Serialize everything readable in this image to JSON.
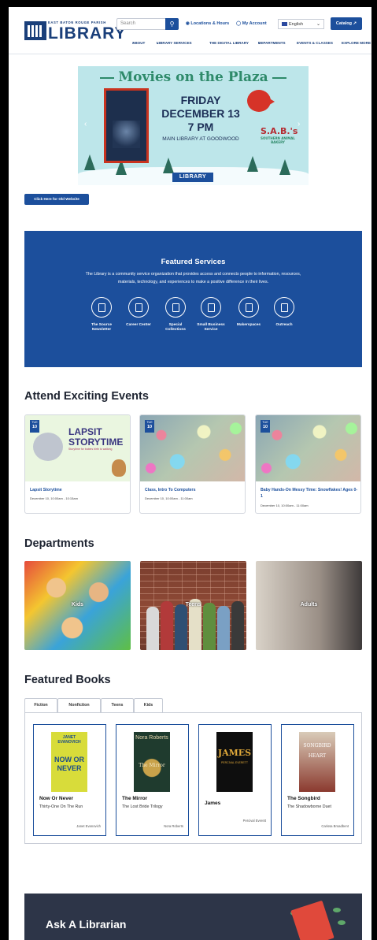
{
  "header": {
    "logo_small": "EAST BATON ROUGE PARISH",
    "logo_big": "LIBRARY",
    "search_placeholder": "Search",
    "locations_label": "Locations & Hours",
    "account_label": "My Account",
    "language": "English",
    "catalog_label": "Catalog",
    "nav": [
      "ABOUT",
      "LIBRARY SERVICES",
      "THE DIGITAL LIBRARY",
      "DEPARTMENTS",
      "EVENTS & CLASSES",
      "EXPLORE MORE"
    ]
  },
  "banner": {
    "title": "Movies on the Plaza",
    "day": "FRIDAY",
    "date": "DECEMBER 13",
    "time": "7 PM",
    "location": "MAIN LIBRARY AT GOODWOOD",
    "sabs": "S.A.B.'s",
    "sabs_sub": "SOUTHERN ANIMAL BAKERY",
    "logo": "LIBRARY"
  },
  "old_site_button": "Click Here for Old Website",
  "featured_services": {
    "title": "Featured Services",
    "description": "The Library is a community service organization that provides access and connects people to information, resources, materials, technology, and experiences to make a positive difference in their lives.",
    "items": [
      {
        "label": "The Source Newsletter",
        "icon": "newsletter-icon"
      },
      {
        "label": "Career Center",
        "icon": "career-icon"
      },
      {
        "label": "Special Collections",
        "icon": "collections-icon"
      },
      {
        "label": "Small Business Service",
        "icon": "business-icon"
      },
      {
        "label": "Makerspaces",
        "icon": "makerspace-icon"
      },
      {
        "label": "Outreach",
        "icon": "outreach-icon"
      }
    ]
  },
  "events": {
    "heading": "Attend Exciting Events",
    "items": [
      {
        "month": "TUE",
        "day": "10",
        "title": "Lapsit Storytime",
        "when": "December 10, 10:00am - 10:15am",
        "img_t1": "LAPSIT",
        "img_t2": "STORYTIME",
        "img_sub": "Storytime for babies birth to walking"
      },
      {
        "month": "TUE",
        "day": "10",
        "title": "Class, Intro To Computers",
        "when": "December 10, 10:00am - 11:00am"
      },
      {
        "month": "TUE",
        "day": "10",
        "title": "Baby Hands-On Messy Time: Snowflakes! Ages 0-1",
        "when": "December 10, 10:00am - 11:00am"
      }
    ]
  },
  "departments": {
    "heading": "Departments",
    "items": [
      "Kids",
      "Teens",
      "Adults"
    ]
  },
  "books": {
    "heading": "Featured Books",
    "tabs": [
      "Fiction",
      "Nonfiction",
      "Teens",
      "Kids"
    ],
    "items": [
      {
        "title": "Now Or Never",
        "subtitle": "Thirty-One On The Run",
        "author": "Janet Evanovich",
        "cover_top": "JANET EVANOVICH",
        "cover_mid": "NOW OR NEVER"
      },
      {
        "title": "The Mirror",
        "subtitle": "The Lost Bride Trilogy",
        "author": "Nora Roberts",
        "cover_top": "Nora Roberts",
        "cover_mid": "The Mirror"
      },
      {
        "title": "James",
        "subtitle": "",
        "author": "Percival Everett",
        "cover_top": "JAMES",
        "cover_mid": "PERCIVAL EVERETT"
      },
      {
        "title": "The Songbird",
        "subtitle": "The Shadowborne Duet",
        "author": "Carissa Broadbent",
        "cover_top": "SONGBIRD",
        "cover_mid": "HEART"
      }
    ]
  },
  "ask": {
    "title": "Ask A Librarian"
  },
  "colors": {
    "primary": "#1c4f9c",
    "dark_band": "#2d3548",
    "banner_bg": "#bde6ea"
  }
}
